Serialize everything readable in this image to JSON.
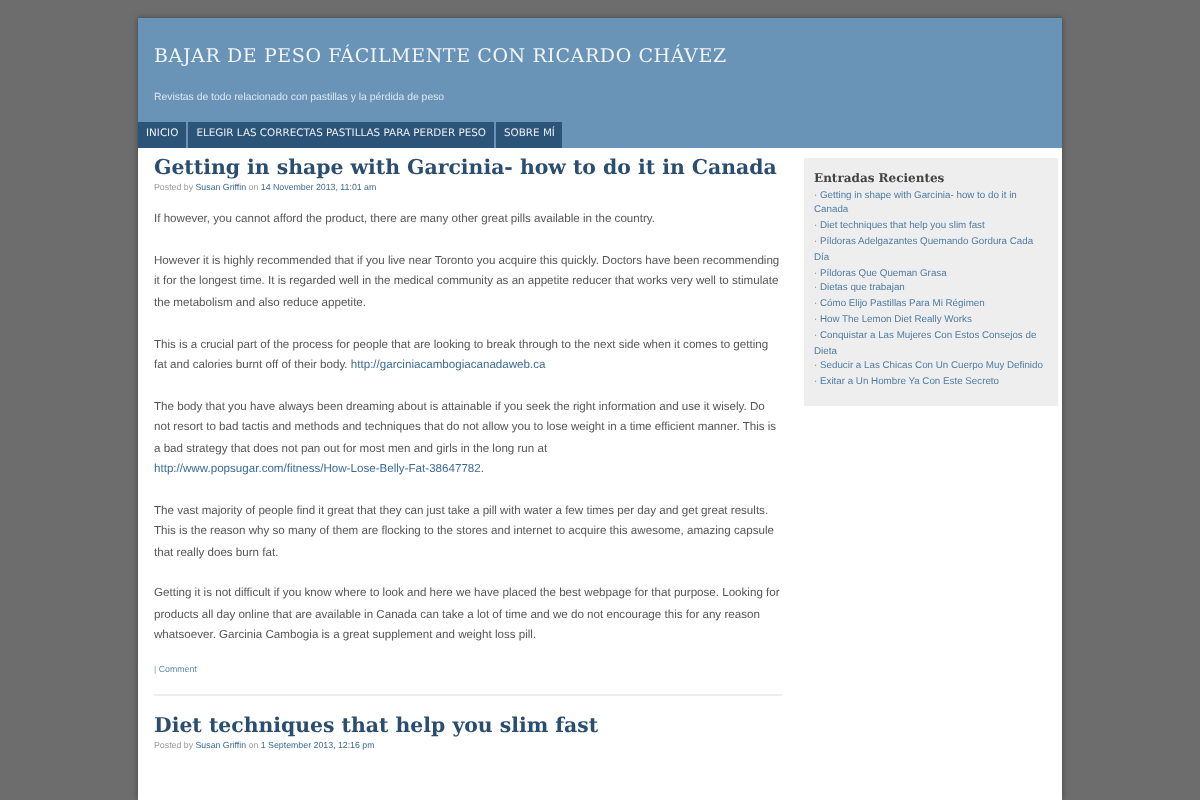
{
  "site": {
    "title": "BAJAR DE PESO FÁCILMENTE CON RICARDO CHÁVEZ",
    "tagline": "Revistas de todo relacionado con pastillas y la pérdida de peso"
  },
  "nav": [
    {
      "label": "INICIO"
    },
    {
      "label": "ELEGIR LAS CORRECTAS PASTILLAS PARA PERDER PESO"
    },
    {
      "label": "SOBRE MÍ"
    }
  ],
  "posts": [
    {
      "title": "Getting in shape with Garcinia- how to do it in Canada",
      "meta": {
        "prefix": "Posted by",
        "author": "Susan Griffin",
        "sep": "on",
        "date": "14 November 2013, 11:01 am"
      },
      "paragraphs": [
        {
          "text": "If however, you cannot afford the product, there are many other great pills available in the country."
        },
        {
          "text": "However it is highly recommended that if you live near Toronto you acquire this quickly. Doctors have been recommending it for the longest time. It is regarded well in the medical community as an appetite reducer that works very well to stimulate the metabolism and also reduce appetite."
        },
        {
          "text": "This is a crucial part of the process for people that are looking to break through to the next side when it comes to getting fat and calories burnt off of their body.",
          "link": "http://garciniacambogiacanadaweb.ca"
        },
        {
          "text": "The body that you have always been dreaming about is attainable if you seek the right information and use it wisely. Do not resort to bad tactis and methods and techniques that do not allow you to lose weight in a time efficient manner. This is a bad strategy that does not pan out for most men and girls in the long run at",
          "link": "http://www.popsugar.com/fitness/How-Lose-Belly-Fat-38647782",
          "after": "."
        },
        {
          "text": "The vast majority of people find it great that they can just take a pill with water a few times per day and get great results. This is the reason why so many of them are flocking to the stores and internet to acquire this awesome, amazing capsule that really does burn fat."
        },
        {
          "text": "Getting it is not difficult if you know where to look and here we have placed the best webpage for that purpose. Looking for products all day online that are available in Canada can take a lot of time and we do not encourage this for any reason whatsoever. Garcinia Cambogia is a great supplement and weight loss pill."
        }
      ],
      "comment": {
        "sep": "|",
        "label": "Comment"
      }
    },
    {
      "title": "Diet techniques that help you slim fast",
      "meta": {
        "prefix": "Posted by",
        "author": "Susan Griffin",
        "sep": "on",
        "date": "1 September 2013, 12:16 pm"
      }
    }
  ],
  "sidebar": {
    "heading": "Entradas Recientes",
    "items": [
      {
        "label": "· Getting in shape with Garcinia- how to do it in Canada"
      },
      {
        "label": "· Diet techniques that help you slim fast"
      },
      {
        "label": "· Píldoras Adelgazantes Quemando Gordura Cada Día"
      },
      {
        "label": "· Píldoras Que Queman Grasa"
      },
      {
        "label": "· Dietas que trabajan"
      },
      {
        "label": "· Cómo Elijo Pastillas Para Mi Régimen"
      },
      {
        "label": "· How The Lemon Diet Really Works"
      },
      {
        "label": "· Conquistar a Las Mujeres Con Estos Consejos de Dieta"
      },
      {
        "label": "· Seducir a Las Chicas Con Un Cuerpo Muy Definido"
      },
      {
        "label": "· Exitar a Un Hombre Ya Con Este Secreto"
      }
    ]
  }
}
